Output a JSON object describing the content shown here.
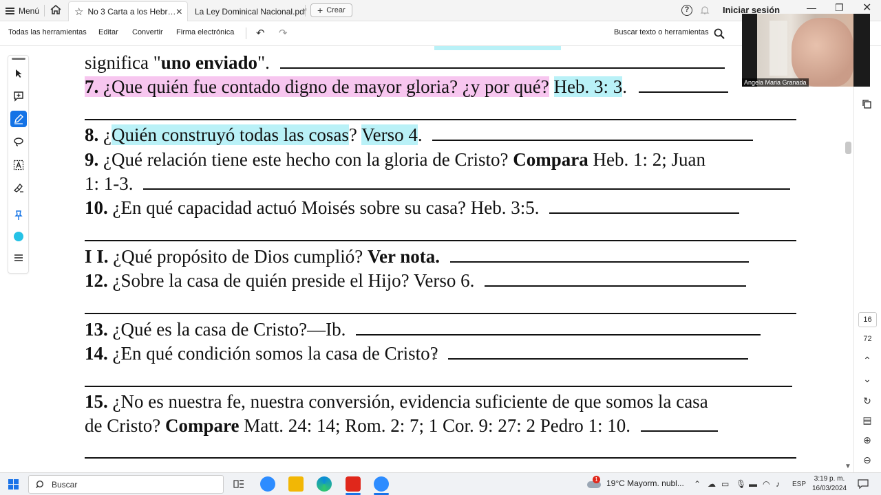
{
  "tabbar": {
    "menu_label": "Menú",
    "active_tab_title": "No 3 Carta a los Hebr…",
    "second_tab_title": "La Ley Dominical Nacional.pdf",
    "create_label": "Crear",
    "signin_label": "Iniciar sesión"
  },
  "toolbar": {
    "all_tools": "Todas las herramientas",
    "edit": "Editar",
    "convert": "Convertir",
    "esign": "Firma electrónica",
    "search_label": "Buscar texto o herramientas"
  },
  "document": {
    "l1_pre": "significa \"",
    "l1_bold": "uno enviado",
    "l1_post": "\".",
    "q7_num": "7.",
    "q7_text": " ¿Que quién fue contado digno de mayor gloria? ¿y por qué?",
    "q7_ref": "Heb. 3: 3",
    "q7_end": ".",
    "q8_num": "8.",
    "q8_pre": " ¿",
    "q8_hl": "Quién construyó todas las cosas",
    "q8_q": "?",
    "q8_ref": "Verso 4",
    "q8_end": ".",
    "q9_num": "9.",
    "q9_text": " ¿Qué relación tiene este hecho con la gloria de Cristo?",
    "q9_bold": "Compara",
    "q9_ref": " Heb. 1: 2; Juan",
    "q9_line2": "1: 1-3.",
    "q10_num": "10.",
    "q10_text": " ¿En qué capacidad actuó Moisés sobre su casa? Heb. 3:5.",
    "q11_num": "I I.",
    "q11_text": " ¿Qué propósito de Dios cumplió?",
    "q11_bold": "Ver nota.",
    "q12_num": "12.",
    "q12_text": " ¿Sobre la casa de quién preside el Hijo? Verso 6.",
    "q13_num": "13.",
    "q13_text": " ¿Qué es la casa de Cristo?—Ib.",
    "q14_num": "14.",
    "q14_text": " ¿En qué condición somos la casa de Cristo?",
    "q15_num": "15.",
    "q15_text": " ¿No es nuestra fe, nuestra conversión, evidencia suficiente de que somos la casa",
    "q15_line2_pre": "de Cristo?",
    "q15_bold": "Compare",
    "q15_line2_post": " Matt. 24: 14; Rom. 2: 7;  1 Cor. 9: 27: 2 Pedro 1: 10."
  },
  "pagenav": {
    "current": "16",
    "total": "72"
  },
  "webcam": {
    "participant_name": "Angela Maria Granada"
  },
  "taskbar": {
    "search_placeholder": "Buscar",
    "weather": "19°C  Mayorm. nubl...",
    "weather_badge": "1",
    "lang": "ESP",
    "time": "3:19 p. m.",
    "date": "16/03/2024"
  },
  "colors": {
    "highlight_pink": "#f7c6ef",
    "highlight_cyan": "#b9f1f7",
    "accent_blue": "#1473e6",
    "acrobat_red": "#e0271b"
  }
}
